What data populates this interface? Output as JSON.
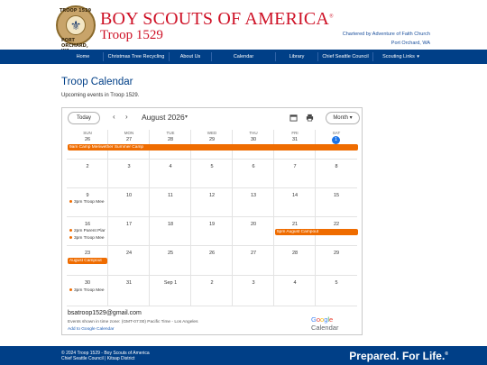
{
  "header": {
    "org_title": "BOY SCOUTS OF AMERICA",
    "org_mark": "®",
    "troop_title": "Troop 1529",
    "charter_line1": "Chartered by Adventure of Faith Church",
    "charter_line2": "Port Orchard, WA",
    "logo_top": "TROOP 1529",
    "logo_bottom": "PORT ORCHARD, WA"
  },
  "nav": {
    "items": [
      "Home",
      "Christmas Tree Recycling",
      "About Us",
      "Calendar",
      "Library",
      "Chief Seattle Council",
      "Scouting Links"
    ],
    "caret": "▼"
  },
  "content": {
    "title": "Troop Calendar",
    "subtitle": "Upcoming events in Troop 1529."
  },
  "calendar": {
    "today_label": "Today",
    "prev": "‹",
    "next": "›",
    "month": "August 2026",
    "month_caret": "▾",
    "view_label": "Month",
    "view_caret": "▾",
    "weekdays": [
      "SUN",
      "MON",
      "TUE",
      "WED",
      "THU",
      "FRI",
      "SAT"
    ],
    "weeks": [
      [
        "26",
        "27",
        "28",
        "29",
        "30",
        "31",
        "1"
      ],
      [
        "2",
        "3",
        "4",
        "5",
        "6",
        "7",
        "8"
      ],
      [
        "9",
        "10",
        "11",
        "12",
        "13",
        "14",
        "15"
      ],
      [
        "16",
        "17",
        "18",
        "19",
        "20",
        "21",
        "22"
      ],
      [
        "23",
        "24",
        "25",
        "26",
        "27",
        "28",
        "29"
      ],
      [
        "30",
        "31",
        "Sep 1",
        "2",
        "3",
        "4",
        "5"
      ]
    ],
    "events": {
      "camp": "9am Camp Meriwether Summer Camp",
      "troop_mtg_1": "3pm Troop Mee",
      "parent_plan": "2pm Parent Plar",
      "troop_mtg_2": "3pm Troop Mee",
      "august_campout_a": "5pm August Campout",
      "august_campout_b": "August Campout",
      "troop_mtg_3": "3pm Troop Mee"
    },
    "email": "bsatroop1529@gmail.com",
    "timezone": "Events shown in time zone: (GMT-07:00) Pacific Time - Los Angeles",
    "add_link": "Add to Google Calendar",
    "brand_google": [
      "G",
      "o",
      "o",
      "g",
      "l",
      "e"
    ],
    "brand_calendar": "Calendar",
    "event_color": "#ef6c00",
    "today_color": "#1a73e8"
  },
  "footer": {
    "copy_line1": "© 2024 Troop 1529 - Boy Scouts of America",
    "copy_line2": "Chief Seattle Council | Kitsap District",
    "slogan": "Prepared. For Life.",
    "slogan_mark": "®"
  }
}
